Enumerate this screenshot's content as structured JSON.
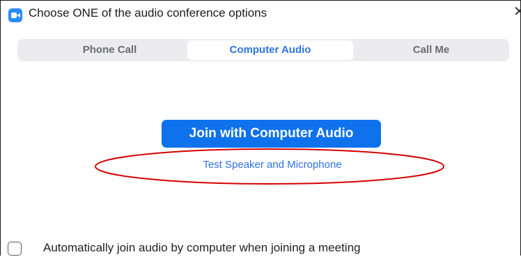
{
  "window": {
    "title": "Choose ONE of the audio conference options",
    "app_icon": "zoom-camera-icon",
    "close_icon": "close-icon",
    "close_glyph": "✕"
  },
  "tabs": [
    {
      "label": "Phone Call",
      "selected": false
    },
    {
      "label": "Computer Audio",
      "selected": true
    },
    {
      "label": "Call Me",
      "selected": false
    }
  ],
  "main": {
    "join_button_label": "Join with Computer Audio",
    "test_link_label": "Test Speaker and Microphone",
    "annotation": "red-ellipse-highlight"
  },
  "footer": {
    "auto_join_label": "Automatically join audio by computer when joining a meeting",
    "auto_join_checked": false
  },
  "colors": {
    "accent": "#0e72ed",
    "link": "#2d72e0",
    "annotation": "#d40000",
    "tab_bar_bg": "#ececee"
  }
}
